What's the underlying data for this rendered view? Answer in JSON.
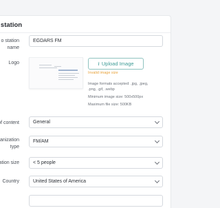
{
  "section_title": "e station",
  "fields": {
    "name": {
      "label_line1": "o station",
      "label_line2": "name",
      "value": "EGDARS FM"
    },
    "logo": {
      "label": "Logo",
      "upload_label": "Upload Image",
      "invalid_text": "Invalid image size",
      "hints": [
        "Image formats accepted: .jpg, .jpeg,",
        ".png, .gif, .webp",
        "Minimum image size: 500x500px",
        "Maximum file size: 500KB"
      ]
    },
    "content_type": {
      "label": "of content",
      "value": "General"
    },
    "organization_type": {
      "label_line1": "anization",
      "label_line2": "type",
      "value": "FM/AM"
    },
    "organization_size": {
      "label": "ation size",
      "value": "< 5 people"
    },
    "country": {
      "label": "Country",
      "value": "United States of America"
    }
  },
  "colors": {
    "accent": "#3e9c97",
    "warning": "#e8a23b"
  },
  "icons": {
    "upload": "upload-icon",
    "chevron": "chevron-down-icon"
  }
}
